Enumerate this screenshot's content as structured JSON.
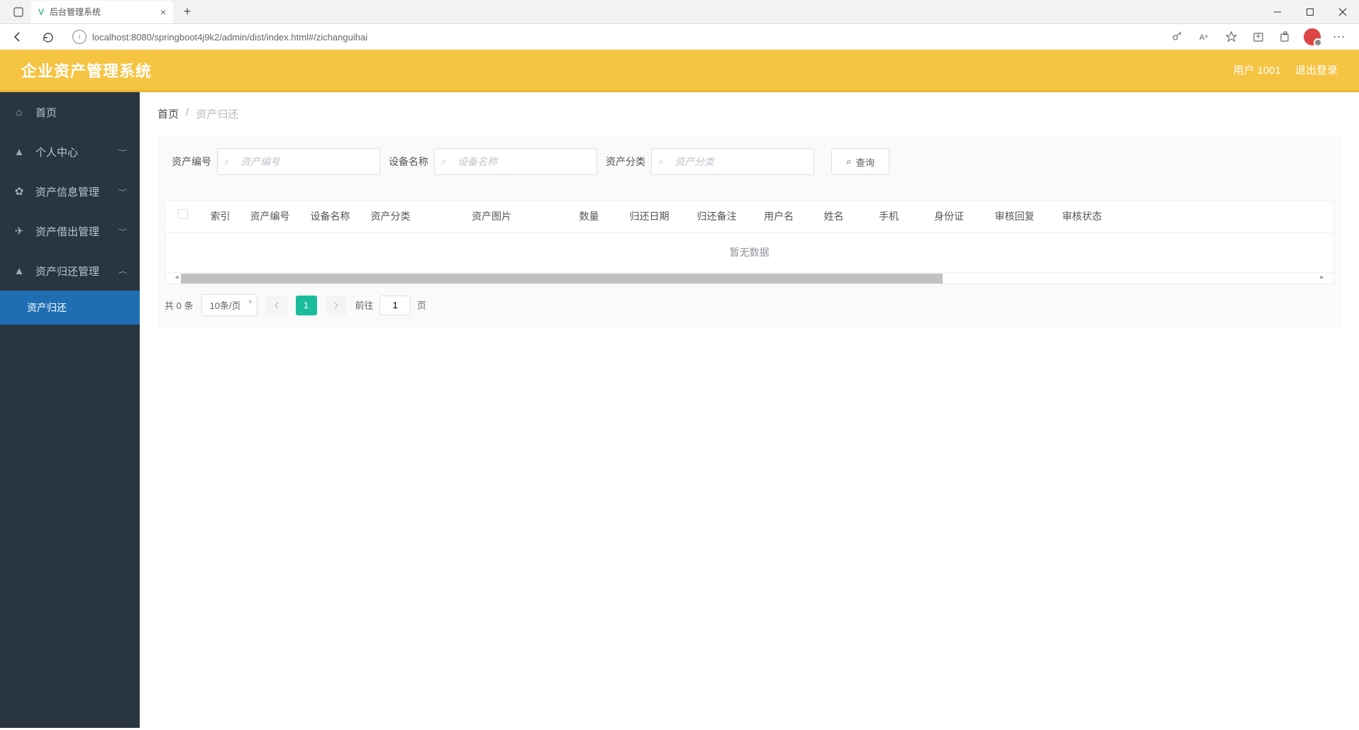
{
  "browser": {
    "tab_title": "后台管理系统",
    "url": "localhost:8080/springboot4j9k2/admin/dist/index.html#/zichanguihai"
  },
  "header": {
    "app_title": "企业资产管理系统",
    "user_label": "用户 1001",
    "logout_label": "退出登录"
  },
  "sidebar": {
    "items": [
      {
        "label": "首页",
        "icon": "home"
      },
      {
        "label": "个人中心",
        "icon": "user",
        "expand": true
      },
      {
        "label": "资产信息管理",
        "icon": "gear",
        "expand": true
      },
      {
        "label": "资产借出管理",
        "icon": "send",
        "expand": true
      },
      {
        "label": "资产归还管理",
        "icon": "user",
        "expand": true,
        "open": true
      }
    ],
    "sub_item_label": "资产归还"
  },
  "breadcrumb": {
    "home": "首页",
    "current": "资产归还"
  },
  "search": {
    "f1_label": "资产编号",
    "f1_placeholder": "资产编号",
    "f2_label": "设备名称",
    "f2_placeholder": "设备名称",
    "f3_label": "资产分类",
    "f3_placeholder": "资产分类",
    "query_btn": "查询"
  },
  "table": {
    "columns": [
      "索引",
      "资产编号",
      "设备名称",
      "资产分类",
      "资产图片",
      "数量",
      "归还日期",
      "归还备注",
      "用户名",
      "姓名",
      "手机",
      "身份证",
      "审核回复",
      "审核状态"
    ],
    "empty_text": "暂无数据"
  },
  "pagination": {
    "total_text": "共 0 条",
    "page_size": "10条/页",
    "current_page": "1",
    "jump_prefix": "前往",
    "jump_value": "1",
    "jump_suffix": "页"
  }
}
